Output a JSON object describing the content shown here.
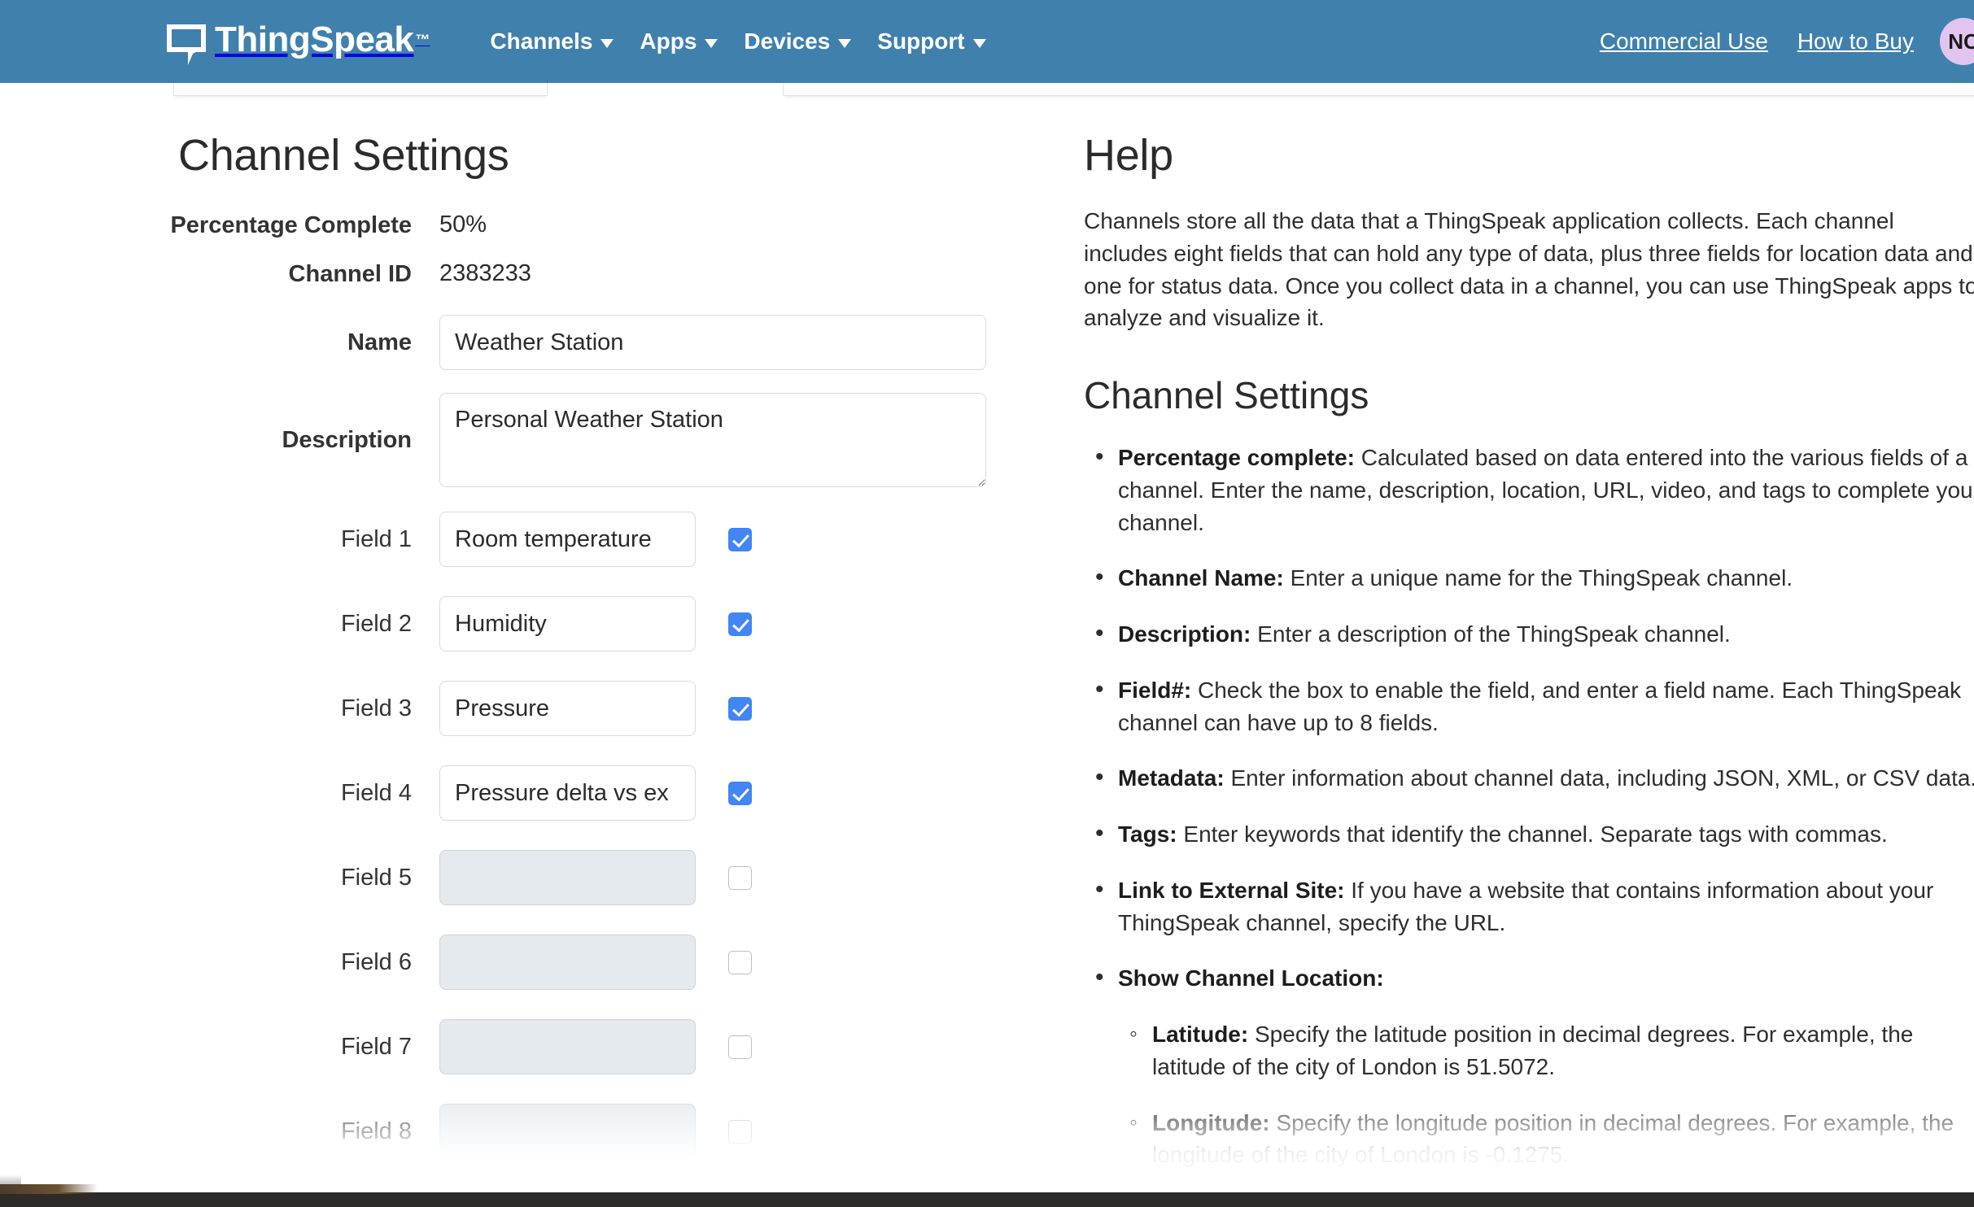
{
  "navbar": {
    "brand": "ThingSpeak",
    "brand_tm": "™",
    "menu": [
      {
        "label": "Channels",
        "has_caret": true
      },
      {
        "label": "Apps",
        "has_caret": true
      },
      {
        "label": "Devices",
        "has_caret": true
      },
      {
        "label": "Support",
        "has_caret": true
      }
    ],
    "right_links": [
      {
        "label": "Commercial Use"
      },
      {
        "label": "How to Buy"
      }
    ],
    "avatar_initials": "NC",
    "brand_icon": "speech-bubble-icon",
    "bg_color": "#4080ad",
    "avatar_color": "#e2c4f0"
  },
  "settings": {
    "title": "Channel Settings",
    "percentage_label": "Percentage Complete",
    "percentage_value": "50%",
    "channel_id_label": "Channel ID",
    "channel_id_value": "2383233",
    "name_label": "Name",
    "name_value": "Weather Station",
    "description_label": "Description",
    "description_value": "Personal Weather Station",
    "fields": [
      {
        "label": "Field 1",
        "value": "Room temperature",
        "enabled": true
      },
      {
        "label": "Field 2",
        "value": "Humidity",
        "enabled": true
      },
      {
        "label": "Field 3",
        "value": "Pressure",
        "enabled": true
      },
      {
        "label": "Field 4",
        "value": "Pressure delta vs ex",
        "enabled": true
      },
      {
        "label": "Field 5",
        "value": "",
        "enabled": false
      },
      {
        "label": "Field 6",
        "value": "",
        "enabled": false
      },
      {
        "label": "Field 7",
        "value": "",
        "enabled": false
      },
      {
        "label": "Field 8",
        "value": "",
        "enabled": false
      }
    ],
    "checkbox_checked_color": "#4285f4"
  },
  "help": {
    "title": "Help",
    "intro": "Channels store all the data that a ThingSpeak application collects. Each channel includes eight fields that can hold any type of data, plus three fields for location data and one for status data. Once you collect data in a channel, you can use ThingSpeak apps to analyze and visualize it.",
    "section_title": "Channel Settings",
    "items": [
      {
        "term": "Percentage complete:",
        "text": " Calculated based on data entered into the various fields of a channel. Enter the name, description, location, URL, video, and tags to complete your channel."
      },
      {
        "term": "Channel Name:",
        "text": " Enter a unique name for the ThingSpeak channel."
      },
      {
        "term": "Description:",
        "text": " Enter a description of the ThingSpeak channel."
      },
      {
        "term": "Field#:",
        "text": " Check the box to enable the field, and enter a field name. Each ThingSpeak channel can have up to 8 fields."
      },
      {
        "term": "Metadata:",
        "text": " Enter information about channel data, including JSON, XML, or CSV data."
      },
      {
        "term": "Tags:",
        "text": " Enter keywords that identify the channel. Separate tags with commas."
      },
      {
        "term": "Link to External Site:",
        "text": " If you have a website that contains information about your ThingSpeak channel, specify the URL."
      },
      {
        "term": "Show Channel Location:",
        "text": ""
      }
    ],
    "sub_items": [
      {
        "term": "Latitude:",
        "text": " Specify the latitude position in decimal degrees. For example, the latitude of the city of London is 51.5072."
      },
      {
        "term": "Longitude:",
        "text": " Specify the longitude position in decimal degrees. For example, the longitude of the city of London is -0.1275."
      }
    ]
  }
}
